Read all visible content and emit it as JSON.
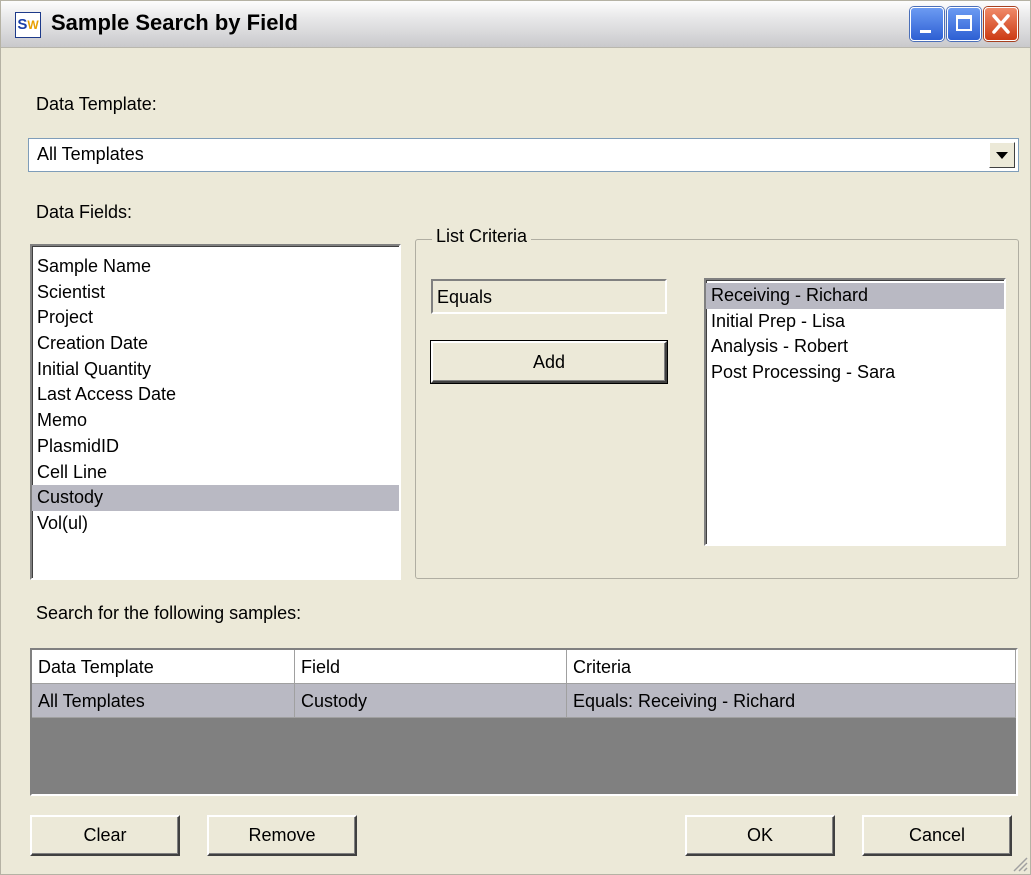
{
  "window": {
    "title": "Sample Search by Field",
    "app_icon_letters": [
      "S",
      "W"
    ]
  },
  "data_template": {
    "label": "Data Template:",
    "selected": "All Templates"
  },
  "data_fields": {
    "label": "Data Fields:",
    "items": [
      "Sample Name",
      "Scientist",
      "Project",
      "Creation Date",
      "Initial Quantity",
      "Last Access Date",
      "Memo",
      "PlasmidID",
      "Cell Line",
      "Custody",
      "Vol(ul)"
    ],
    "selected_index": 9
  },
  "list_criteria": {
    "legend": "List Criteria",
    "operator": "Equals",
    "add_label": "Add",
    "values": [
      "Receiving - Richard",
      "Initial Prep - Lisa",
      "Analysis - Robert",
      "Post Processing - Sara"
    ],
    "selected_index": 0
  },
  "results": {
    "label": "Search for the following samples:",
    "columns": [
      "Data Template",
      "Field",
      "Criteria"
    ],
    "rows": [
      [
        "All Templates",
        "Custody",
        "Equals: Receiving - Richard"
      ]
    ]
  },
  "buttons": {
    "clear": "Clear",
    "remove": "Remove",
    "ok": "OK",
    "cancel": "Cancel"
  },
  "colors": {
    "window_bg": "#ece9d8",
    "selection": "#b9b9c3",
    "grid_empty": "#808080",
    "close_button": "#e05a32",
    "title_button": "#3a6fe0"
  }
}
